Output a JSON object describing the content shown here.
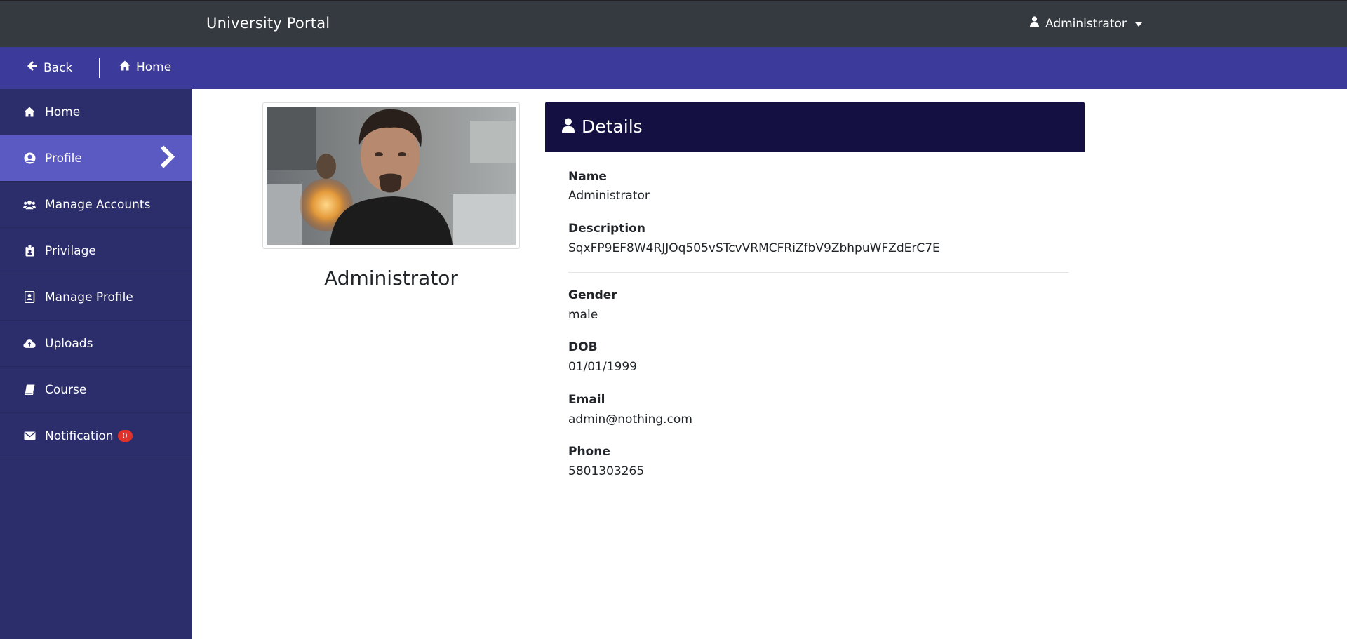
{
  "header": {
    "brand": "University Portal",
    "user_label": "Administrator"
  },
  "subnav": {
    "back_label": "Back",
    "home_label": "Home"
  },
  "sidebar": {
    "items": [
      {
        "label": "Home",
        "icon": "home-icon"
      },
      {
        "label": "Profile",
        "icon": "user-circle-icon",
        "active": true
      },
      {
        "label": "Manage Accounts",
        "icon": "users-icon"
      },
      {
        "label": "Privilage",
        "icon": "badge-icon"
      },
      {
        "label": "Manage Profile",
        "icon": "address-book-icon"
      },
      {
        "label": "Uploads",
        "icon": "cloud-upload-icon"
      },
      {
        "label": "Course",
        "icon": "book-icon"
      },
      {
        "label": "Notification",
        "icon": "envelope-icon",
        "badge": "0"
      }
    ]
  },
  "profile": {
    "name": "Administrator"
  },
  "details": {
    "title": "Details",
    "fields": [
      {
        "label": "Name",
        "value": "Administrator"
      },
      {
        "label": "Description",
        "value": "SqxFP9EF8W4RJJOq505vSTcvVRMCFRiZfbV9ZbhpuWFZdErC7E"
      },
      {
        "label": "Gender",
        "value": "male"
      },
      {
        "label": "DOB",
        "value": "01/01/1999"
      },
      {
        "label": "Email",
        "value": "admin@nothing.com"
      },
      {
        "label": "Phone",
        "value": "5801303265"
      }
    ]
  },
  "colors": {
    "topbar": "#343a40",
    "subnav": "#3c3a9b",
    "sidebar": "#2c2d6b",
    "sidebar_active": "#5a5ac2",
    "details_header": "#141142",
    "badge": "#e0312a"
  }
}
